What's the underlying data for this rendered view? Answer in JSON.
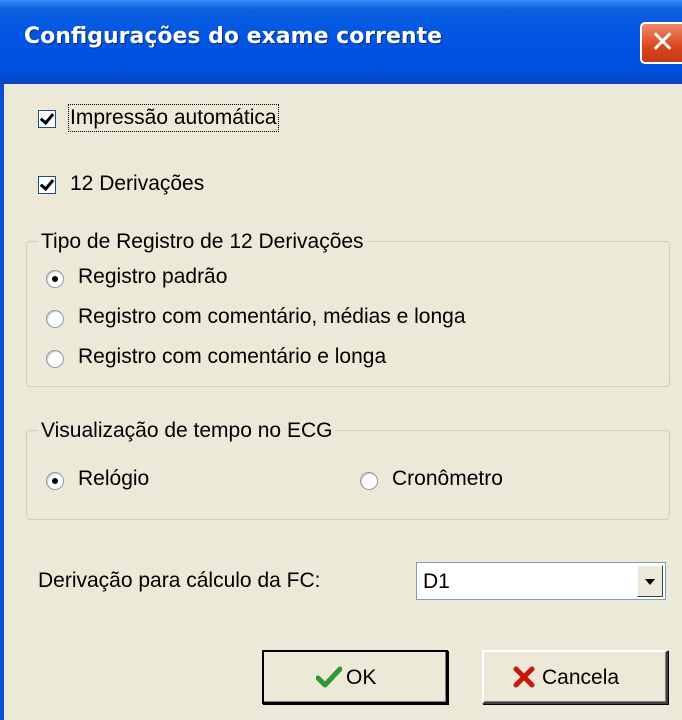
{
  "window": {
    "title": "Configurações do exame corrente",
    "close_glyph": "✕"
  },
  "options": {
    "auto_print": {
      "label": "Impressão automática",
      "checked": true
    },
    "twelve_leads": {
      "label": "12 Derivações",
      "checked": true
    }
  },
  "record_type_group": {
    "legend": "Tipo de Registro de 12 Derivações",
    "options": [
      {
        "label": "Registro padrão",
        "selected": true
      },
      {
        "label": "Registro com comentário, médias e longa",
        "selected": false
      },
      {
        "label": "Registro com comentário e longa",
        "selected": false
      }
    ]
  },
  "time_display_group": {
    "legend": "Visualização de tempo no ECG",
    "options": [
      {
        "label": "Relógio",
        "selected": true
      },
      {
        "label": "Cronômetro",
        "selected": false
      }
    ]
  },
  "hr_lead": {
    "label": "Derivação para cálculo da FC:",
    "value": "D1"
  },
  "buttons": {
    "ok_label": "OK",
    "cancel_label": "Cancela"
  },
  "colors": {
    "titlebar": "#0154E3",
    "window_bg": "#ECE9D8",
    "close_button": "#D8461E",
    "ok_icon": "#2E9A2E",
    "cancel_icon": "#C8170F"
  },
  "icons": {
    "ok": "check-icon",
    "cancel": "x-icon",
    "close": "close-icon",
    "dropdown": "chevron-down-icon"
  }
}
